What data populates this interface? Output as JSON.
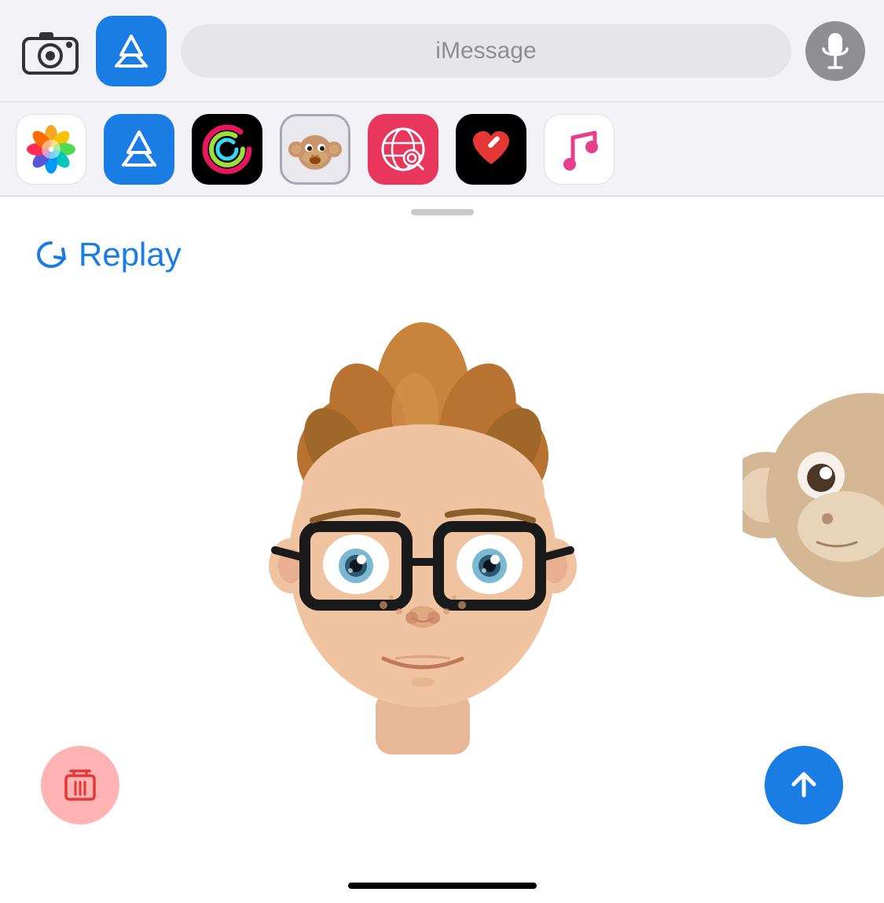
{
  "toolbar": {
    "imessage_placeholder": "iMessage"
  },
  "app_row": {
    "apps": [
      {
        "name": "Photos",
        "icon_type": "photos"
      },
      {
        "name": "App Store",
        "icon_type": "appstore"
      },
      {
        "name": "Activity",
        "icon_type": "activity"
      },
      {
        "name": "Memoji",
        "icon_type": "memoji"
      },
      {
        "name": "Search",
        "icon_type": "search"
      },
      {
        "name": "Heart Chat",
        "icon_type": "heartchat"
      },
      {
        "name": "Music",
        "icon_type": "music"
      }
    ]
  },
  "main": {
    "replay_label": "Replay"
  },
  "colors": {
    "accent_blue": "#1a7de4",
    "delete_bg": "#ffb3b3",
    "delete_icon": "#e63737"
  }
}
